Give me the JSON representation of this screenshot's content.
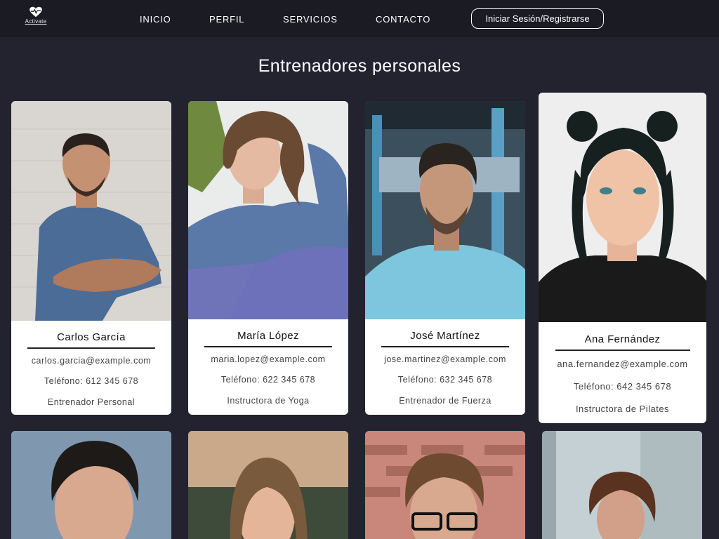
{
  "nav": {
    "logo_text": "Activate",
    "links": [
      "INICIO",
      "PERFIL",
      "SERVICIOS",
      "CONTACTO"
    ],
    "login_label": "Iniciar Sesión/Registrarse"
  },
  "page": {
    "title": "Entrenadores personales"
  },
  "trainers": [
    {
      "name": "Carlos García",
      "email": "carlos.garcia@example.com",
      "phone": "Teléfono: 612 345 678",
      "role": "Entrenador Personal"
    },
    {
      "name": "María López",
      "email": "maria.lopez@example.com",
      "phone": "Teléfono: 622 345 678",
      "role": "Instructora de Yoga"
    },
    {
      "name": "José Martínez",
      "email": "jose.martinez@example.com",
      "phone": "Teléfono: 632 345 678",
      "role": "Entrenador de Fuerza"
    },
    {
      "name": "Ana Fernández",
      "email": "ana.fernandez@example.com",
      "phone": "Teléfono: 642 345 678",
      "role": "Instructora de Pilates"
    }
  ],
  "colors": {
    "background": "#232330",
    "navbar": "#1b1b24",
    "card": "#ffffff"
  }
}
